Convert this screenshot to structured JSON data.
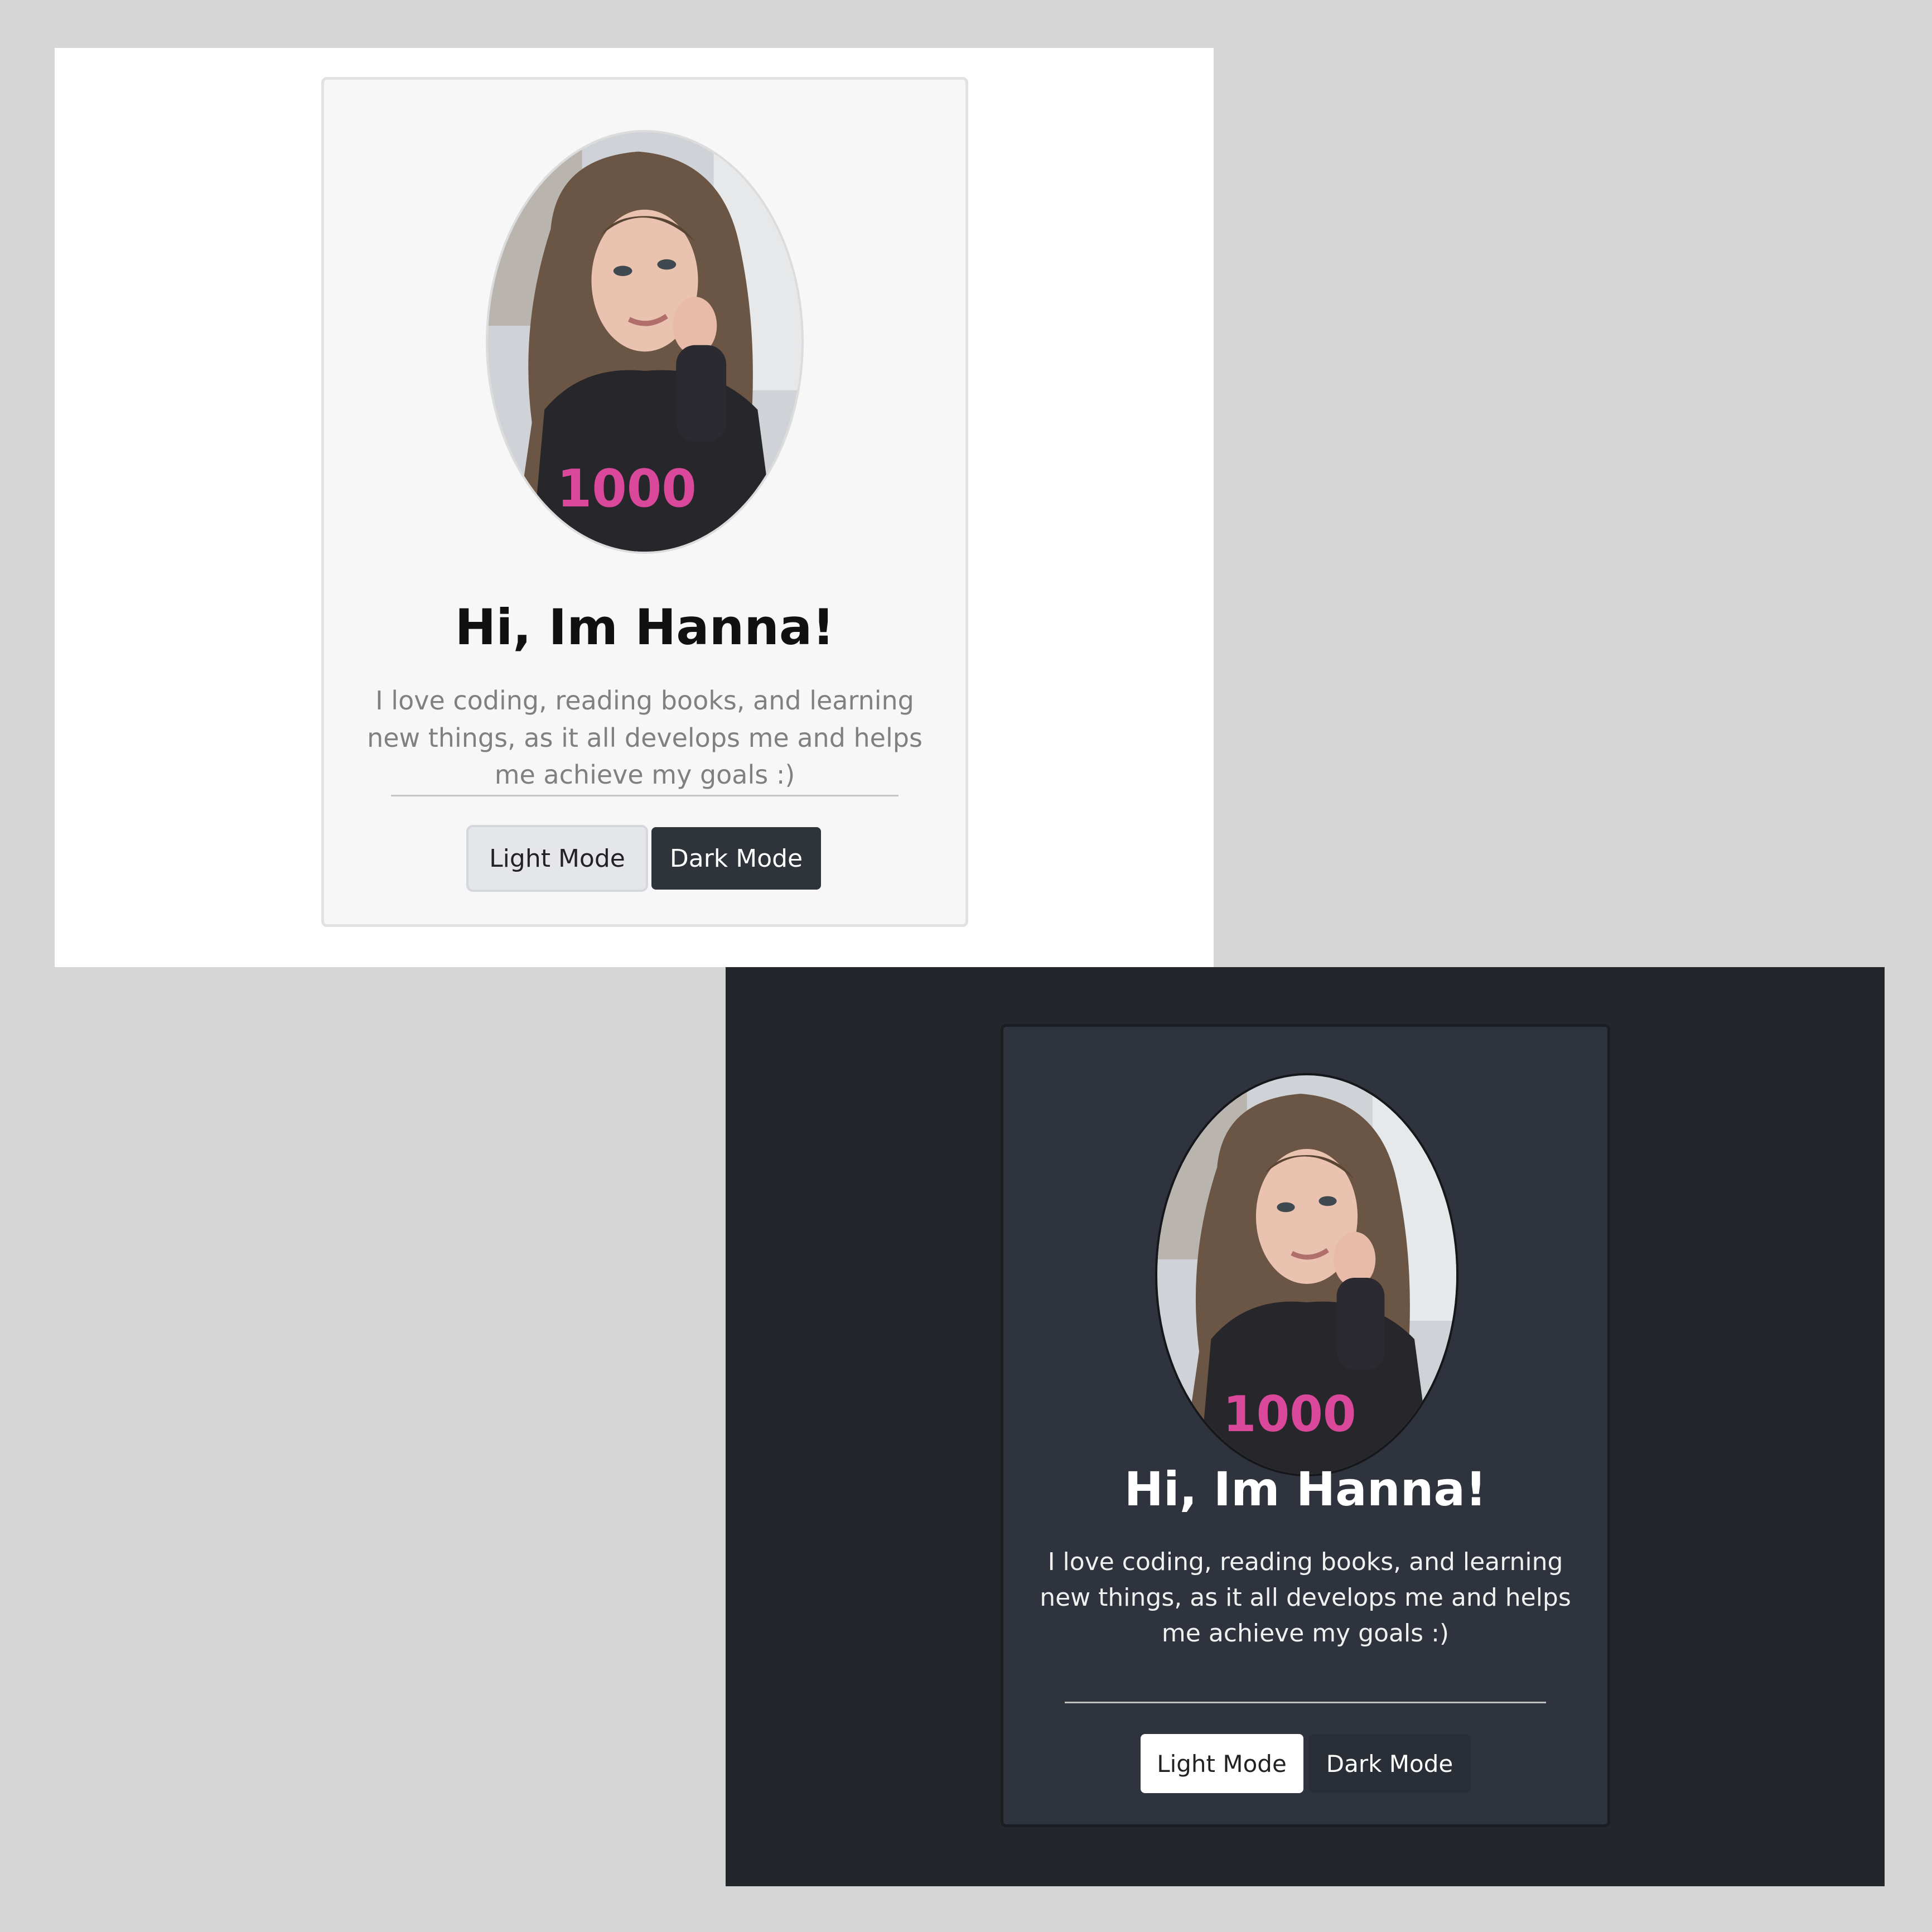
{
  "profile": {
    "title": "Hi, Im Hanna!",
    "description": "I love coding, reading books, and learning new things, as it all develops me and helps me achieve my goals :)",
    "photo_alt": "Profile photo of Hanna",
    "shirt_print": "1000"
  },
  "controls": {
    "light_mode_label": "Light Mode",
    "dark_mode_label": "Dark Mode"
  },
  "themes": {
    "light": {
      "page_background": "#ffffff",
      "card_background": "#f7f7f7",
      "title_color": "#111111",
      "text_color": "#808080"
    },
    "dark": {
      "page_background": "#23272c",
      "card_background": "#2f333d",
      "title_color": "#ffffff",
      "text_color": "#f0f0f0"
    }
  }
}
